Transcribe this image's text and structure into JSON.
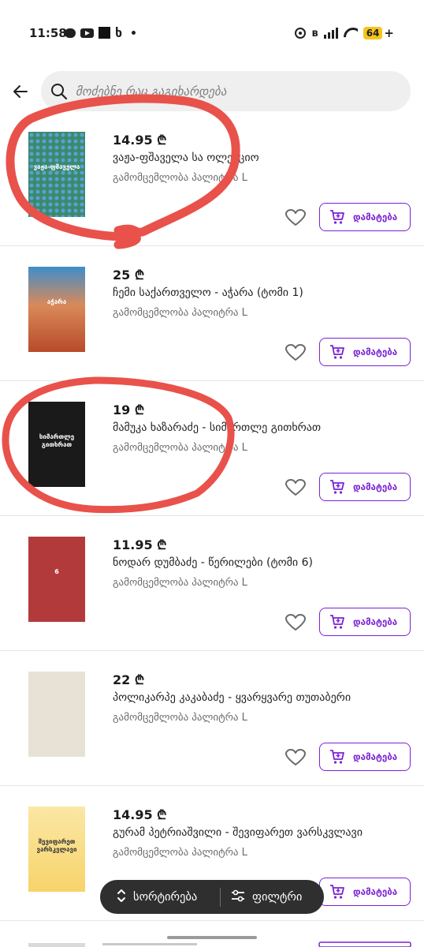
{
  "status_bar": {
    "time": "11:58",
    "left_letter": "ხ",
    "battery": "64",
    "battery_plus": "+",
    "bluetooth": "ʙ",
    "icons": [
      "chat-icon",
      "youtube-icon",
      "app-square-icon",
      "dot-icon",
      "alarm-icon",
      "bluetooth-icon",
      "signal-icon",
      "wifi-icon",
      "battery-icon"
    ]
  },
  "search": {
    "placeholder": "მოძებნე რაც გაგიხარდება",
    "value": ""
  },
  "products": [
    {
      "price": "14.95 ₾",
      "name": "ვაჟა-ფშაველა სა ოლექციო",
      "publisher": "გამომცემლობა პალიტრა L",
      "cover_title": "ვაჟა-ფშაველა",
      "cover_bg": "#3a8a6a"
    },
    {
      "price": "25 ₾",
      "name": "ჩემი საქართველო - აჭარა (ტომი 1)",
      "publisher": "გამომცემლობა პალიტრა L",
      "cover_title": "აჭარა",
      "cover_bg": "#c86a4a"
    },
    {
      "price": "19 ₾",
      "name": "მამუკა ხაზარაძე - სიმართლე გითხრათ",
      "publisher": "გამომცემლობა პალიტრა L",
      "cover_title": "სიმართლე გითხრათ",
      "cover_bg": "#1a1a1a"
    },
    {
      "price": "11.95 ₾",
      "name": "ნოდარ დუმბაძე - წერილები (ტომი 6)",
      "publisher": "გამომცემლობა პალიტრა L",
      "cover_title": "6",
      "cover_bg": "#b33a3a"
    },
    {
      "price": "22 ₾",
      "name": "პოლიკარპე კაკაბაძე - ყვარყვარე თუთაბერი",
      "publisher": "გამომცემლობა პალიტრა L",
      "cover_title": "",
      "cover_bg": "#e8e2d6"
    },
    {
      "price": "14.95 ₾",
      "name": "გურამ პეტრიაშვილი - შევიფარეთ ვარსკვლავი",
      "publisher": "გამომცემლობა პალიტრა L",
      "cover_title": "შევიფარეთ ვარსკვლავი",
      "cover_bg": "#fbe7a5"
    }
  ],
  "actions": {
    "add_label": "დამატება"
  },
  "bottom_bar": {
    "sort_label": "სორტირება",
    "filter_label": "ფილტრი"
  },
  "colors": {
    "accent": "#7b22d4",
    "annotation": "#e8524a",
    "bar_bg": "#2f2f2f"
  }
}
